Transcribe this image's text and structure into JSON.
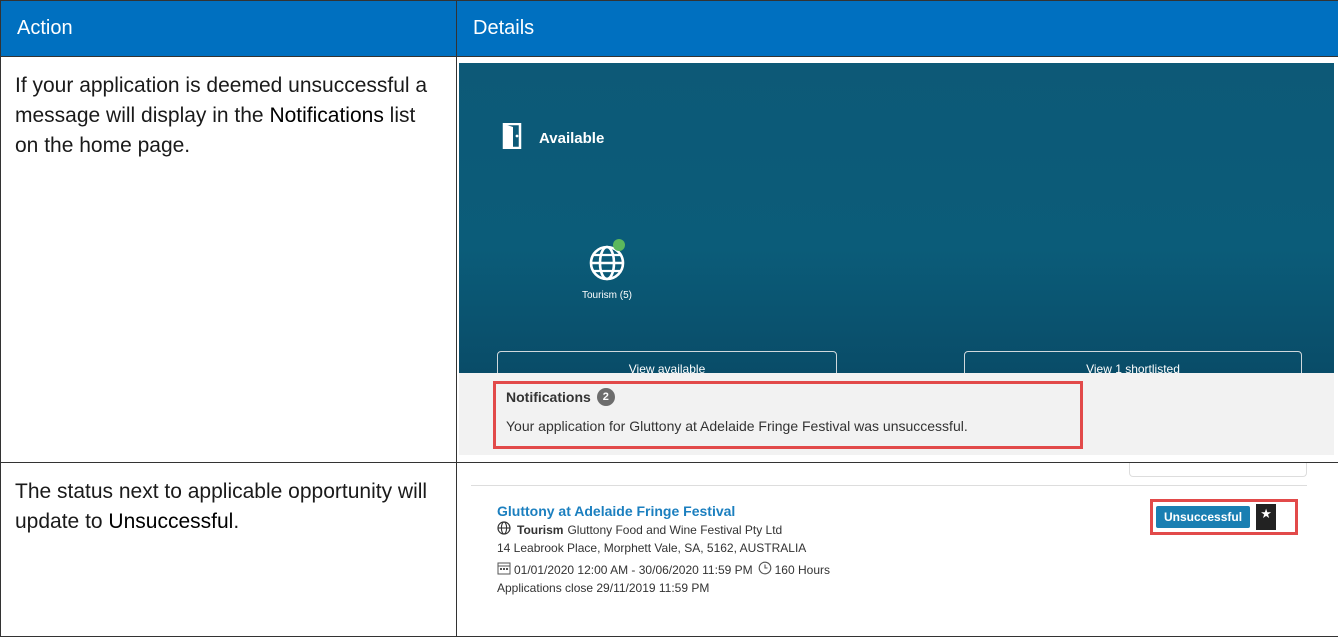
{
  "table": {
    "headers": [
      "Action",
      "Details"
    ],
    "rows": [
      {
        "action_pre": "If your application is deemed unsuccessful a message will display in the ",
        "action_bold": "Notifications",
        "action_post": " list on the home page."
      },
      {
        "action_pre": "The status next to applicable opportunity will update to ",
        "action_bold": "Unsuccessful",
        "action_post": "."
      }
    ]
  },
  "home": {
    "available_label": "Available",
    "tourism_label": "Tourism (5)",
    "view_available": "View available",
    "view_shortlisted": "View 1 shortlisted",
    "notifications_title": "Notifications",
    "notifications_count": "2",
    "notification_message": "Your application for Gluttony at Adelaide Fringe Festival was unsuccessful.",
    "online_dot_color": "#5cb85c"
  },
  "opportunity": {
    "title": "Gluttony at Adelaide Fringe Festival",
    "category": "Tourism",
    "organisation": "Gluttony Food and Wine Festival Pty Ltd",
    "address": "14 Leabrook Place, Morphett Vale, SA, 5162, AUSTRALIA",
    "dates": "01/01/2020 12:00 AM - 30/06/2020 11:59 PM",
    "hours": "160 Hours",
    "closing": "Applications close 29/11/2019 11:59 PM",
    "status": "Unsuccessful"
  },
  "colors": {
    "header_bg": "#0070c0",
    "highlight": "#e24a4a",
    "status_bg": "#1a7fb2",
    "title_link": "#1b7fbf"
  }
}
